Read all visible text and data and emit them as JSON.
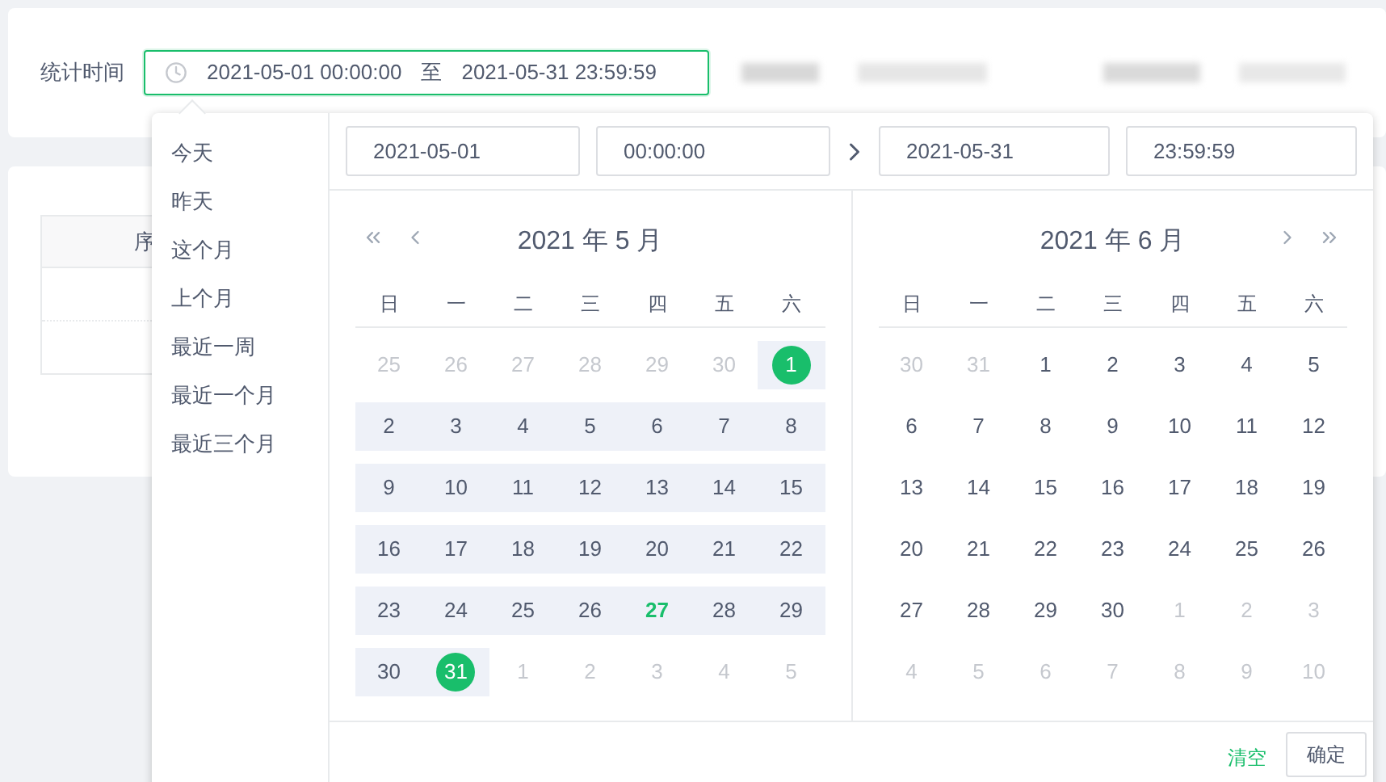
{
  "filter": {
    "label": "统计时间",
    "range_field": {
      "start": "2021-05-01 00:00:00",
      "separator": "至",
      "end": "2021-05-31 23:59:59",
      "focused": true
    }
  },
  "table": {
    "column_1": "序"
  },
  "picker": {
    "shortcuts": [
      "今天",
      "昨天",
      "这个月",
      "上个月",
      "最近一周",
      "最近一个月",
      "最近三个月"
    ],
    "inputs": {
      "start_date": "2021-05-01",
      "start_time": "00:00:00",
      "end_date": "2021-05-31",
      "end_time": "23:59:59"
    },
    "calendars": [
      {
        "title": "2021 年 5 月",
        "weekdays": [
          "日",
          "一",
          "二",
          "三",
          "四",
          "五",
          "六"
        ],
        "weeks": [
          [
            {
              "day": "25",
              "outside": true,
              "in_range": false,
              "selected": false,
              "today": false
            },
            {
              "day": "26",
              "outside": true,
              "in_range": false,
              "selected": false,
              "today": false
            },
            {
              "day": "27",
              "outside": true,
              "in_range": false,
              "selected": false,
              "today": false
            },
            {
              "day": "28",
              "outside": true,
              "in_range": false,
              "selected": false,
              "today": false
            },
            {
              "day": "29",
              "outside": true,
              "in_range": false,
              "selected": false,
              "today": false
            },
            {
              "day": "30",
              "outside": true,
              "in_range": false,
              "selected": false,
              "today": false
            },
            {
              "day": "1",
              "outside": false,
              "in_range": true,
              "selected": true,
              "today": false
            }
          ],
          [
            {
              "day": "2",
              "outside": false,
              "in_range": true,
              "selected": false,
              "today": false
            },
            {
              "day": "3",
              "outside": false,
              "in_range": true,
              "selected": false,
              "today": false
            },
            {
              "day": "4",
              "outside": false,
              "in_range": true,
              "selected": false,
              "today": false
            },
            {
              "day": "5",
              "outside": false,
              "in_range": true,
              "selected": false,
              "today": false
            },
            {
              "day": "6",
              "outside": false,
              "in_range": true,
              "selected": false,
              "today": false
            },
            {
              "day": "7",
              "outside": false,
              "in_range": true,
              "selected": false,
              "today": false
            },
            {
              "day": "8",
              "outside": false,
              "in_range": true,
              "selected": false,
              "today": false
            }
          ],
          [
            {
              "day": "9",
              "outside": false,
              "in_range": true,
              "selected": false,
              "today": false
            },
            {
              "day": "10",
              "outside": false,
              "in_range": true,
              "selected": false,
              "today": false
            },
            {
              "day": "11",
              "outside": false,
              "in_range": true,
              "selected": false,
              "today": false
            },
            {
              "day": "12",
              "outside": false,
              "in_range": true,
              "selected": false,
              "today": false
            },
            {
              "day": "13",
              "outside": false,
              "in_range": true,
              "selected": false,
              "today": false
            },
            {
              "day": "14",
              "outside": false,
              "in_range": true,
              "selected": false,
              "today": false
            },
            {
              "day": "15",
              "outside": false,
              "in_range": true,
              "selected": false,
              "today": false
            }
          ],
          [
            {
              "day": "16",
              "outside": false,
              "in_range": true,
              "selected": false,
              "today": false
            },
            {
              "day": "17",
              "outside": false,
              "in_range": true,
              "selected": false,
              "today": false
            },
            {
              "day": "18",
              "outside": false,
              "in_range": true,
              "selected": false,
              "today": false
            },
            {
              "day": "19",
              "outside": false,
              "in_range": true,
              "selected": false,
              "today": false
            },
            {
              "day": "20",
              "outside": false,
              "in_range": true,
              "selected": false,
              "today": false
            },
            {
              "day": "21",
              "outside": false,
              "in_range": true,
              "selected": false,
              "today": false
            },
            {
              "day": "22",
              "outside": false,
              "in_range": true,
              "selected": false,
              "today": false
            }
          ],
          [
            {
              "day": "23",
              "outside": false,
              "in_range": true,
              "selected": false,
              "today": false
            },
            {
              "day": "24",
              "outside": false,
              "in_range": true,
              "selected": false,
              "today": false
            },
            {
              "day": "25",
              "outside": false,
              "in_range": true,
              "selected": false,
              "today": false
            },
            {
              "day": "26",
              "outside": false,
              "in_range": true,
              "selected": false,
              "today": false
            },
            {
              "day": "27",
              "outside": false,
              "in_range": true,
              "selected": false,
              "today": true
            },
            {
              "day": "28",
              "outside": false,
              "in_range": true,
              "selected": false,
              "today": false
            },
            {
              "day": "29",
              "outside": false,
              "in_range": true,
              "selected": false,
              "today": false
            }
          ],
          [
            {
              "day": "30",
              "outside": false,
              "in_range": true,
              "selected": false,
              "today": false
            },
            {
              "day": "31",
              "outside": false,
              "in_range": true,
              "selected": true,
              "today": false
            },
            {
              "day": "1",
              "outside": true,
              "in_range": false,
              "selected": false,
              "today": false
            },
            {
              "day": "2",
              "outside": true,
              "in_range": false,
              "selected": false,
              "today": false
            },
            {
              "day": "3",
              "outside": true,
              "in_range": false,
              "selected": false,
              "today": false
            },
            {
              "day": "4",
              "outside": true,
              "in_range": false,
              "selected": false,
              "today": false
            },
            {
              "day": "5",
              "outside": true,
              "in_range": false,
              "selected": false,
              "today": false
            }
          ]
        ]
      },
      {
        "title": "2021 年 6 月",
        "weekdays": [
          "日",
          "一",
          "二",
          "三",
          "四",
          "五",
          "六"
        ],
        "weeks": [
          [
            {
              "day": "30",
              "outside": true,
              "in_range": false,
              "selected": false,
              "today": false
            },
            {
              "day": "31",
              "outside": true,
              "in_range": false,
              "selected": false,
              "today": false
            },
            {
              "day": "1",
              "outside": false,
              "in_range": false,
              "selected": false,
              "today": false
            },
            {
              "day": "2",
              "outside": false,
              "in_range": false,
              "selected": false,
              "today": false
            },
            {
              "day": "3",
              "outside": false,
              "in_range": false,
              "selected": false,
              "today": false
            },
            {
              "day": "4",
              "outside": false,
              "in_range": false,
              "selected": false,
              "today": false
            },
            {
              "day": "5",
              "outside": false,
              "in_range": false,
              "selected": false,
              "today": false
            }
          ],
          [
            {
              "day": "6",
              "outside": false,
              "in_range": false,
              "selected": false,
              "today": false
            },
            {
              "day": "7",
              "outside": false,
              "in_range": false,
              "selected": false,
              "today": false
            },
            {
              "day": "8",
              "outside": false,
              "in_range": false,
              "selected": false,
              "today": false
            },
            {
              "day": "9",
              "outside": false,
              "in_range": false,
              "selected": false,
              "today": false
            },
            {
              "day": "10",
              "outside": false,
              "in_range": false,
              "selected": false,
              "today": false
            },
            {
              "day": "11",
              "outside": false,
              "in_range": false,
              "selected": false,
              "today": false
            },
            {
              "day": "12",
              "outside": false,
              "in_range": false,
              "selected": false,
              "today": false
            }
          ],
          [
            {
              "day": "13",
              "outside": false,
              "in_range": false,
              "selected": false,
              "today": false
            },
            {
              "day": "14",
              "outside": false,
              "in_range": false,
              "selected": false,
              "today": false
            },
            {
              "day": "15",
              "outside": false,
              "in_range": false,
              "selected": false,
              "today": false
            },
            {
              "day": "16",
              "outside": false,
              "in_range": false,
              "selected": false,
              "today": false
            },
            {
              "day": "17",
              "outside": false,
              "in_range": false,
              "selected": false,
              "today": false
            },
            {
              "day": "18",
              "outside": false,
              "in_range": false,
              "selected": false,
              "today": false
            },
            {
              "day": "19",
              "outside": false,
              "in_range": false,
              "selected": false,
              "today": false
            }
          ],
          [
            {
              "day": "20",
              "outside": false,
              "in_range": false,
              "selected": false,
              "today": false
            },
            {
              "day": "21",
              "outside": false,
              "in_range": false,
              "selected": false,
              "today": false
            },
            {
              "day": "22",
              "outside": false,
              "in_range": false,
              "selected": false,
              "today": false
            },
            {
              "day": "23",
              "outside": false,
              "in_range": false,
              "selected": false,
              "today": false
            },
            {
              "day": "24",
              "outside": false,
              "in_range": false,
              "selected": false,
              "today": false
            },
            {
              "day": "25",
              "outside": false,
              "in_range": false,
              "selected": false,
              "today": false
            },
            {
              "day": "26",
              "outside": false,
              "in_range": false,
              "selected": false,
              "today": false
            }
          ],
          [
            {
              "day": "27",
              "outside": false,
              "in_range": false,
              "selected": false,
              "today": false
            },
            {
              "day": "28",
              "outside": false,
              "in_range": false,
              "selected": false,
              "today": false
            },
            {
              "day": "29",
              "outside": false,
              "in_range": false,
              "selected": false,
              "today": false
            },
            {
              "day": "30",
              "outside": false,
              "in_range": false,
              "selected": false,
              "today": false
            },
            {
              "day": "1",
              "outside": true,
              "in_range": false,
              "selected": false,
              "today": false
            },
            {
              "day": "2",
              "outside": true,
              "in_range": false,
              "selected": false,
              "today": false
            },
            {
              "day": "3",
              "outside": true,
              "in_range": false,
              "selected": false,
              "today": false
            }
          ],
          [
            {
              "day": "4",
              "outside": true,
              "in_range": false,
              "selected": false,
              "today": false
            },
            {
              "day": "5",
              "outside": true,
              "in_range": false,
              "selected": false,
              "today": false
            },
            {
              "day": "6",
              "outside": true,
              "in_range": false,
              "selected": false,
              "today": false
            },
            {
              "day": "7",
              "outside": true,
              "in_range": false,
              "selected": false,
              "today": false
            },
            {
              "day": "8",
              "outside": true,
              "in_range": false,
              "selected": false,
              "today": false
            },
            {
              "day": "9",
              "outside": true,
              "in_range": false,
              "selected": false,
              "today": false
            },
            {
              "day": "10",
              "outside": true,
              "in_range": false,
              "selected": false,
              "today": false
            }
          ]
        ]
      }
    ],
    "footer": {
      "clear": "清空",
      "confirm": "确定"
    }
  }
}
